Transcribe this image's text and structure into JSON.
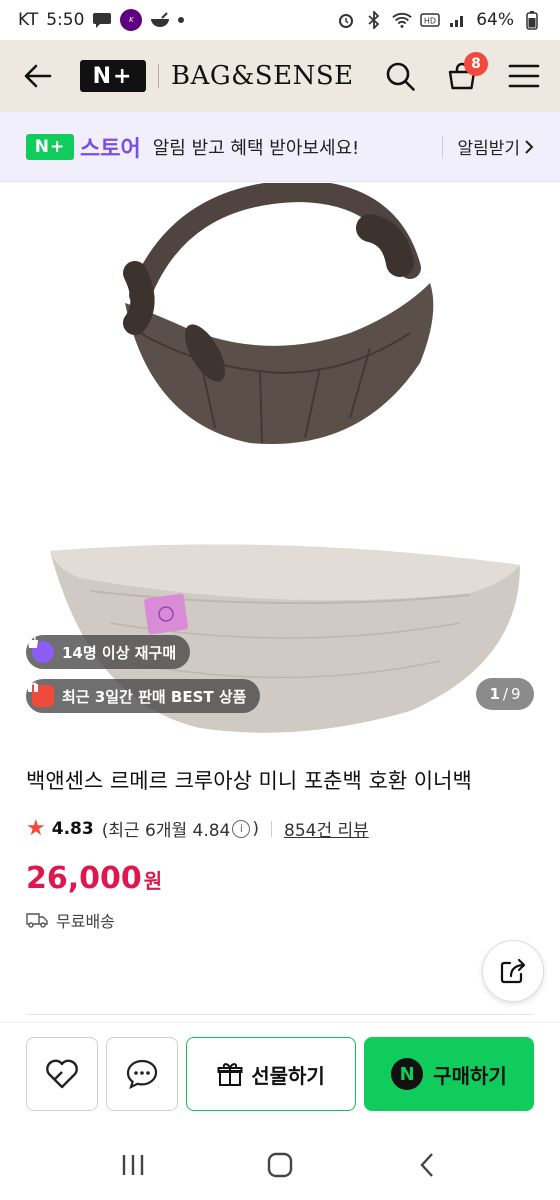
{
  "status_bar": {
    "carrier": "KT",
    "time": "5:50",
    "battery": "64%"
  },
  "header": {
    "nplus_logo": "N+",
    "brand": "BAG&SENSE",
    "cart_count": "8",
    "icons": [
      "back-arrow-icon",
      "search-icon",
      "cart-icon",
      "menu-icon"
    ]
  },
  "banner": {
    "logo": "N+",
    "store": "스토어",
    "message": "알림 받고 혜택 받아보세요!",
    "cta": "알림받기",
    "cta_icon": "chevron-right-icon"
  },
  "gallery": {
    "chips": [
      {
        "label": "14명 이상 재구매",
        "icon": "bag-icon",
        "color": "#8b5cf6"
      },
      {
        "label": "최근 3일간 판매 BEST 상품",
        "icon": "gift-box-icon",
        "color": "#f04a3d"
      }
    ],
    "current": "1",
    "total": "9"
  },
  "product": {
    "title": "백앤센스 르메르 크루아상 미니 포춘백 호환 이너백",
    "rating": "4.83",
    "rating_recent": "(최근 6개월 4.84",
    "rating_close": ")",
    "reviews": "854건 리뷰",
    "price": "26,000",
    "currency": "원",
    "shipping": "무료배송"
  },
  "action_bar": {
    "gift_label": "선물하기",
    "buy_label": "구매하기",
    "buy_badge": "N"
  },
  "colors": {
    "accent_green": "#0fcc5d",
    "price_red": "#e0174f",
    "header_bg": "#ede8e0",
    "banner_bg": "#f1effb",
    "store_purple": "#7b4ee6"
  }
}
